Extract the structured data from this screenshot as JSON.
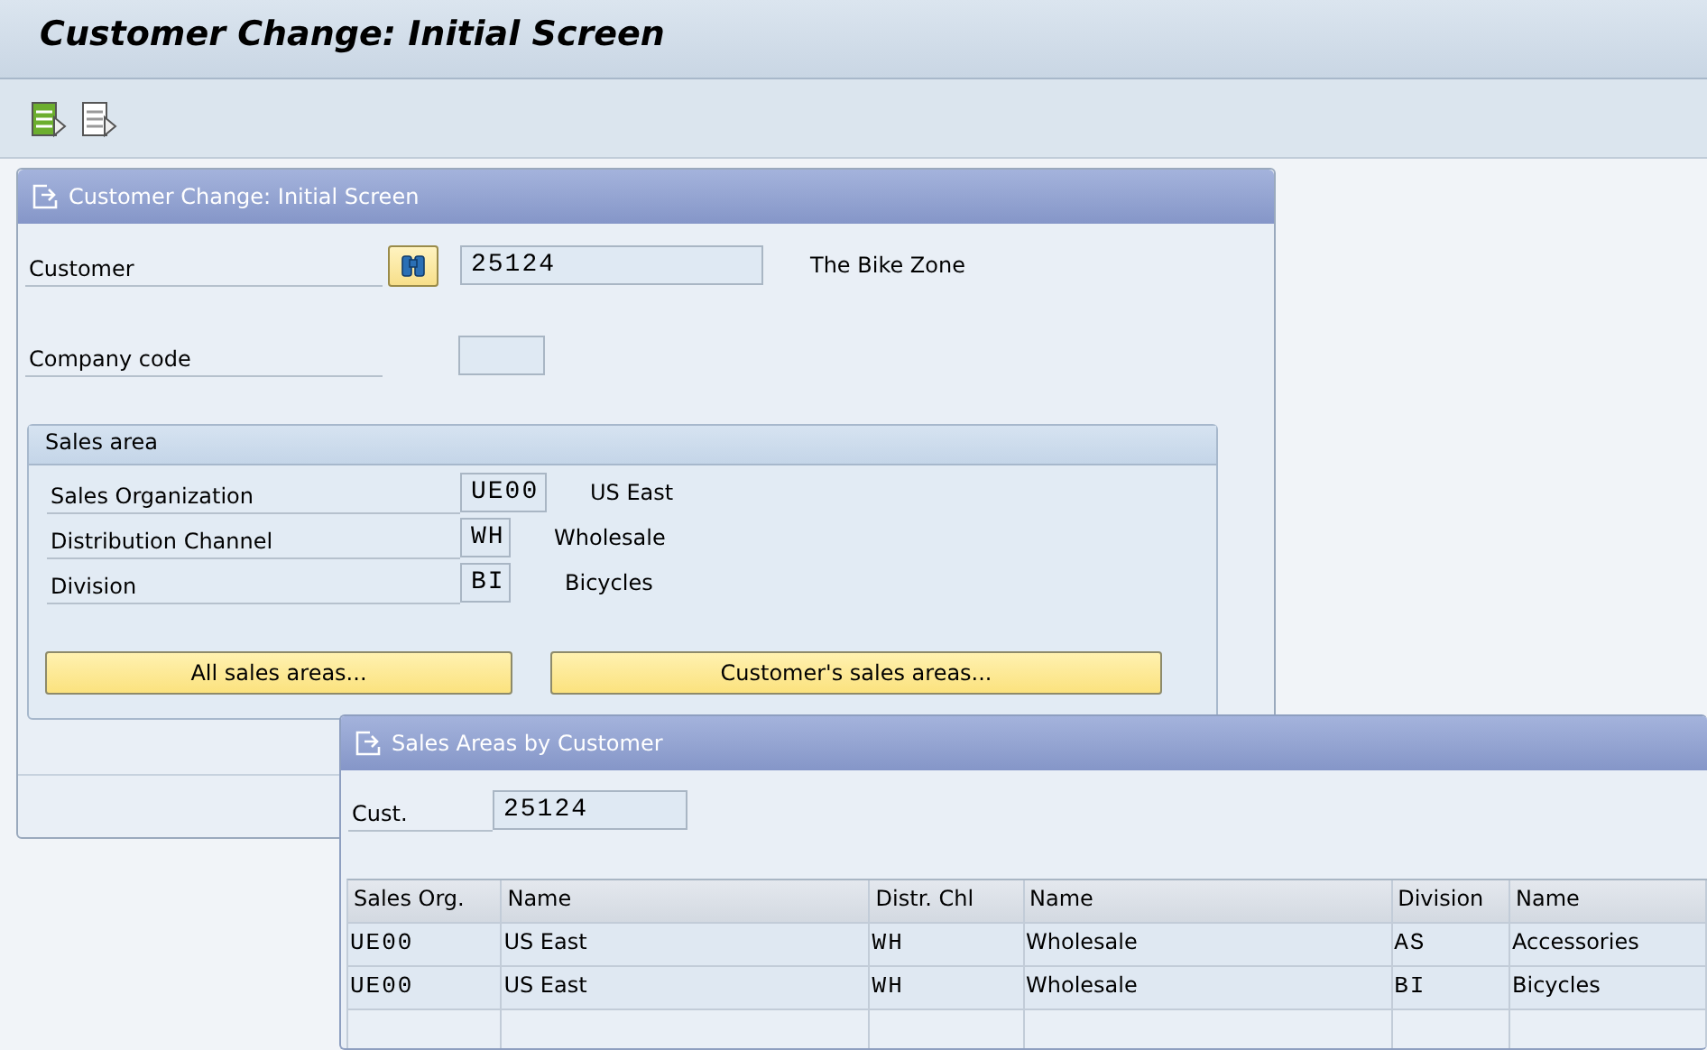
{
  "title": "Customer Change: Initial Screen",
  "panel": {
    "title": "Customer Change: Initial Screen",
    "fields": [
      {
        "label": "Customer",
        "value": "25124",
        "description": "The Bike Zone",
        "search_help": true
      },
      {
        "label": "Company code",
        "search_help": false
      }
    ],
    "sales_area": {
      "title": "Sales area",
      "fields": [
        {
          "label": "Sales Organization",
          "value": "UE00",
          "description": "US East"
        },
        {
          "label": "Distribution Channel",
          "value": "WH",
          "description": "Wholesale"
        },
        {
          "label": "Division",
          "value": "BI",
          "description": "Bicycles"
        }
      ]
    },
    "buttons": [
      "All sales areas...",
      "Customer's sales areas..."
    ]
  },
  "popup": {
    "title": "Sales Areas by Customer",
    "field": {
      "label": "Cust.",
      "value": "25124"
    },
    "table": {
      "columns": [
        "Sales Org.",
        "Name",
        "Distr. Chl",
        "Name",
        "Division",
        "Name"
      ],
      "rows": [
        [
          "UE00",
          "US East",
          "WH",
          "Wholesale",
          "AS",
          "Accessories"
        ],
        [
          "UE00",
          "US East",
          "WH",
          "Wholesale",
          "BI",
          "Bicycles"
        ]
      ]
    }
  }
}
